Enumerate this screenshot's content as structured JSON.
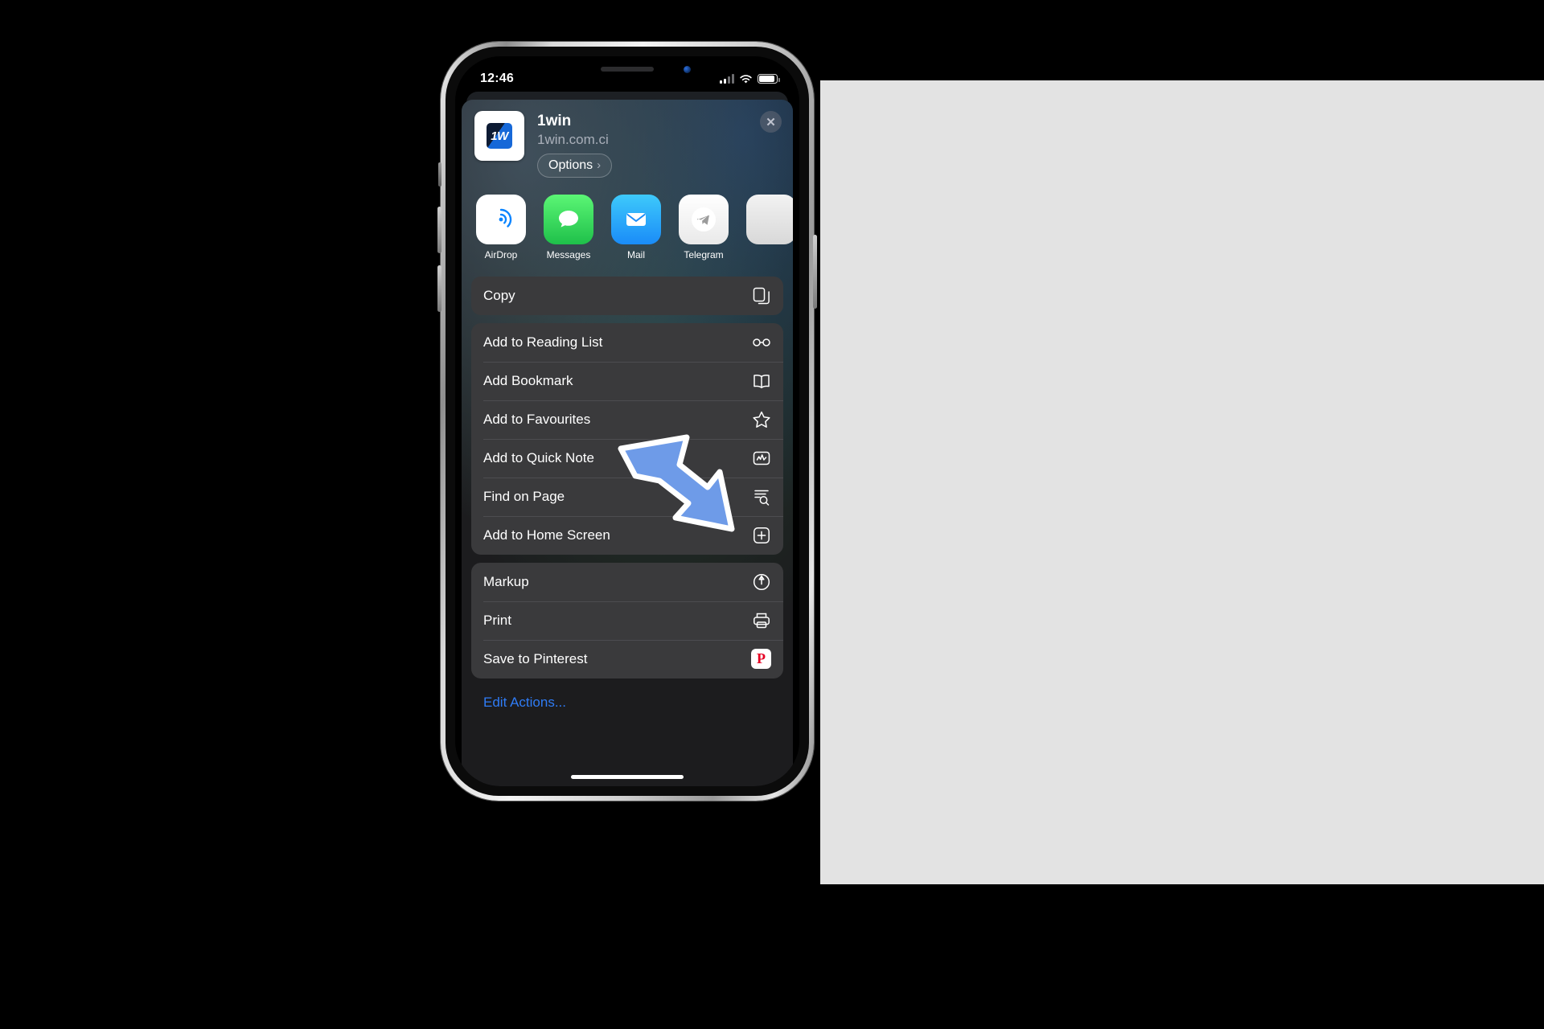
{
  "status_bar": {
    "time": "12:46",
    "signal_icon": "cellular-signal-icon",
    "wifi_icon": "wifi-icon",
    "battery_icon": "battery-icon"
  },
  "share_sheet": {
    "header": {
      "app_name": "1win",
      "url": "1win.com.ci",
      "icon_text": "1W",
      "options_label": "Options",
      "options_chevron": "›",
      "close_label": "✕"
    },
    "apps": [
      {
        "name": "AirDrop",
        "icon": "airdrop-icon"
      },
      {
        "name": "Messages",
        "icon": "messages-icon"
      },
      {
        "name": "Mail",
        "icon": "mail-icon"
      },
      {
        "name": "Telegram",
        "icon": "telegram-icon"
      },
      {
        "name": "",
        "icon": "more-apps-icon"
      }
    ],
    "groups": [
      {
        "items": [
          {
            "label": "Copy",
            "icon": "copy-icon"
          }
        ]
      },
      {
        "items": [
          {
            "label": "Add to Reading List",
            "icon": "glasses-icon"
          },
          {
            "label": "Add Bookmark",
            "icon": "book-icon"
          },
          {
            "label": "Add to Favourites",
            "icon": "star-icon"
          },
          {
            "label": "Add to Quick Note",
            "icon": "quick-note-icon"
          },
          {
            "label": "Find on Page",
            "icon": "find-on-page-icon"
          },
          {
            "label": "Add to Home Screen",
            "icon": "add-to-home-screen-icon"
          }
        ]
      },
      {
        "items": [
          {
            "label": "Markup",
            "icon": "markup-icon"
          },
          {
            "label": "Print",
            "icon": "printer-icon"
          },
          {
            "label": "Save to Pinterest",
            "icon": "pinterest-icon"
          }
        ]
      }
    ],
    "edit_actions_label": "Edit Actions..."
  },
  "annotation": {
    "arrow": "blue-pointer-arrow",
    "color": "#6E9BE8"
  },
  "colors": {
    "sheet_background": "#1c1c1e",
    "group_background": "#3a3a3c",
    "link_blue": "#2F7CF6",
    "text_primary": "#ffffff",
    "text_secondary": "rgba(235,235,245,.62)"
  }
}
